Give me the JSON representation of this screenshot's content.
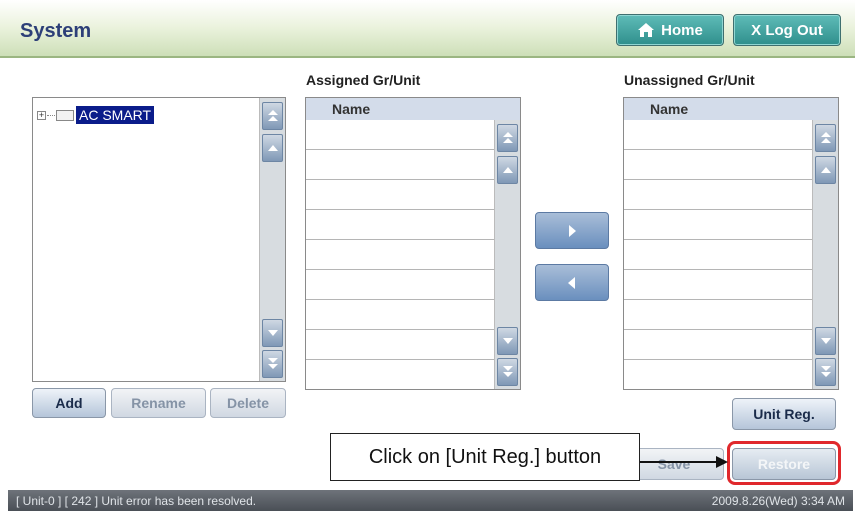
{
  "header": {
    "title": "System",
    "home_label": "Home",
    "logout_label": "X Log Out"
  },
  "tree": {
    "expander": "+",
    "node_label": "AC SMART"
  },
  "assigned": {
    "label": "Assigned Gr/Unit",
    "column": "Name"
  },
  "unassigned": {
    "label": "Unassigned Gr/Unit",
    "column": "Name"
  },
  "buttons": {
    "add": "Add",
    "rename": "Rename",
    "delete": "Delete",
    "unit_reg": "Unit Reg.",
    "save": "Save",
    "restore": "Restore"
  },
  "callout": {
    "text": "Click on [Unit Reg.] button"
  },
  "status": {
    "message": "[ Unit-0 ] [ 242 ] Unit error has been resolved.",
    "datetime": "2009.8.26(Wed)  3:34 AM"
  },
  "colors": {
    "highlight": "#e0282c",
    "header_accent": "#2d3f78"
  }
}
